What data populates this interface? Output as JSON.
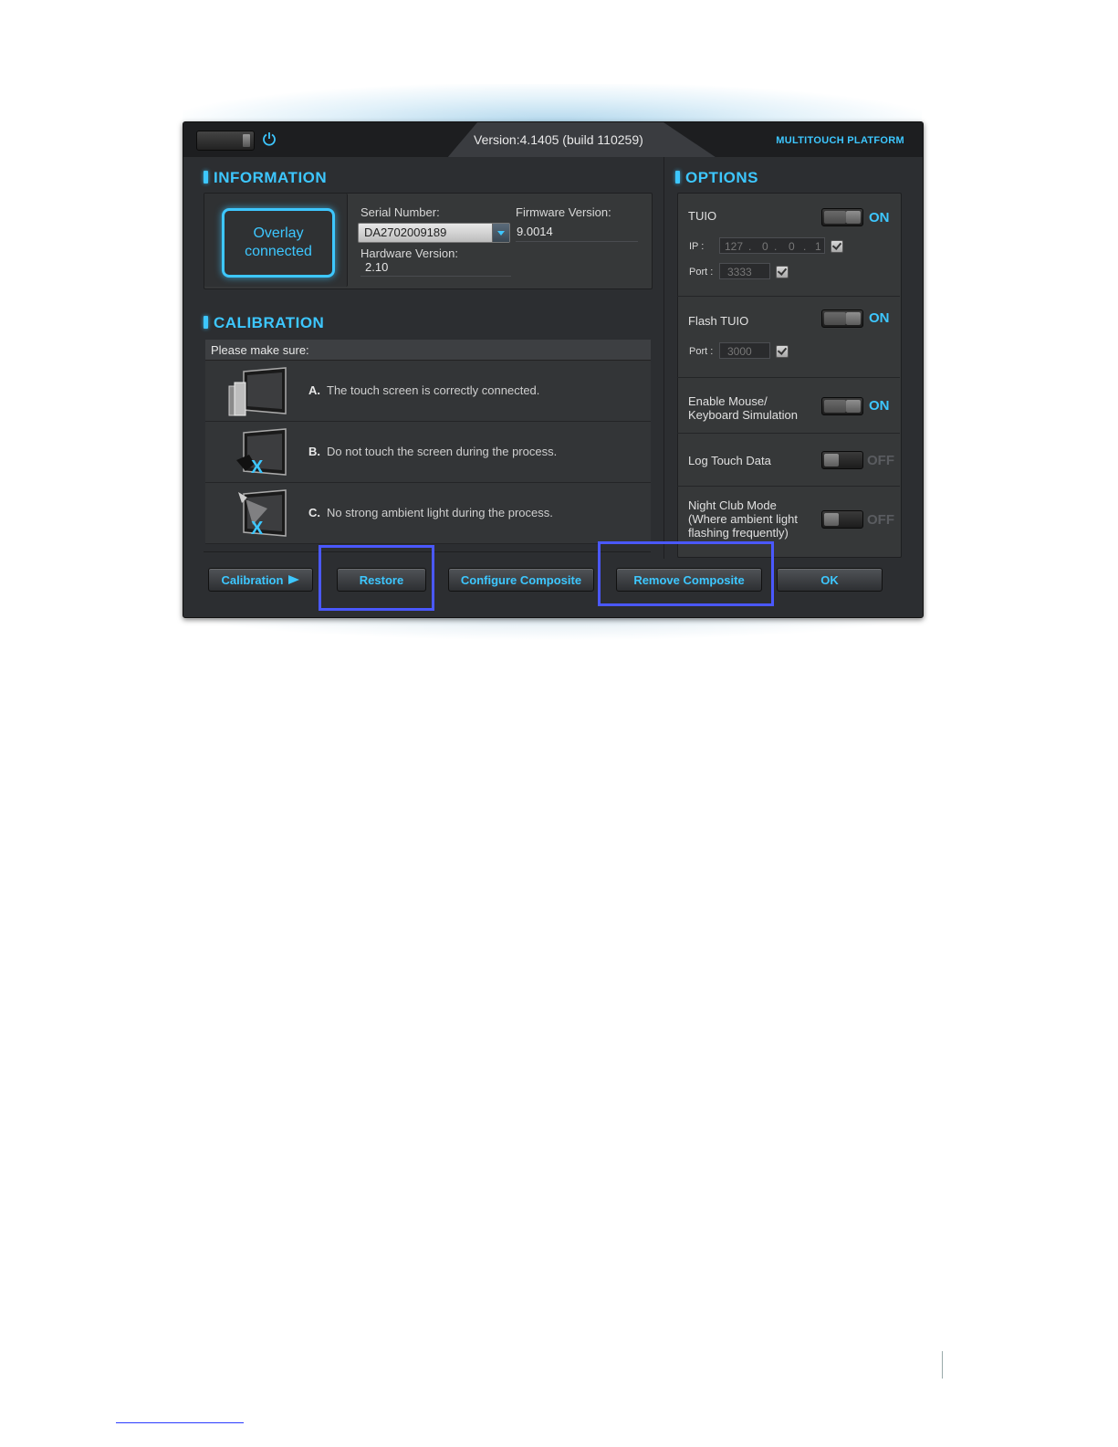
{
  "header": {
    "version": "Version:4.1405 (build 110259)",
    "brand": "MULTITOUCH PLATFORM"
  },
  "information": {
    "title": "INFORMATION",
    "overlay_status": "Overlay connected",
    "serial_label": "Serial Number:",
    "serial_value": "DA2702009189",
    "firmware_label": "Firmware Version:",
    "firmware_value": "9.0014",
    "hardware_label": "Hardware Version:",
    "hardware_value": "2.10"
  },
  "calibration": {
    "title": "CALIBRATION",
    "header": "Please make sure:",
    "items": [
      {
        "letter": "A.",
        "text": "The touch screen is correctly connected."
      },
      {
        "letter": "B.",
        "text": "Do not touch the screen during the process."
      },
      {
        "letter": "C.",
        "text": "No strong ambient light during the process."
      }
    ],
    "mark_x": "X"
  },
  "options": {
    "title": "OPTIONS",
    "tuio": {
      "label": "TUIO",
      "state": "ON",
      "ip_label": "IP :",
      "ip": [
        "127",
        "0",
        "0",
        "1"
      ],
      "ip_dot": ".",
      "port_label": "Port :",
      "port": "3333"
    },
    "flash_tuio": {
      "label": "Flash TUIO",
      "state": "ON",
      "port_label": "Port :",
      "port": "3000"
    },
    "mouse": {
      "label_line1": "Enable Mouse/",
      "label_line2": "Keyboard Simulation",
      "state": "ON"
    },
    "log": {
      "label": "Log Touch Data",
      "state": "OFF"
    },
    "night": {
      "label_line1": "Night Club Mode",
      "label_line2": "(Where ambient light",
      "label_line3": "flashing frequently)",
      "state": "OFF"
    }
  },
  "buttons": {
    "calibration": "Calibration",
    "restore": "Restore",
    "configure": "Configure Composite",
    "remove": "Remove Composite",
    "ok": "OK"
  },
  "colors": {
    "accent": "#3dc7ff",
    "highlight": "#4a58ff",
    "window_bg": "#2c2e31"
  }
}
